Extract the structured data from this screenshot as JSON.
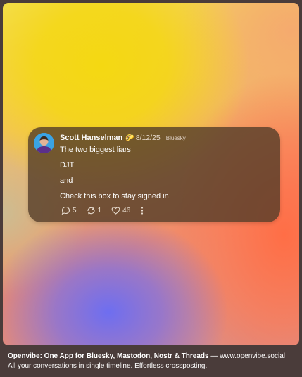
{
  "post": {
    "author": "Scott Hanselman",
    "badge": "🌮",
    "date": "8/12/25",
    "network": "Bluesky",
    "lines": [
      "The two biggest liars",
      "DJT",
      "and",
      "Check this box to stay signed in"
    ],
    "replies": "5",
    "reposts": "1",
    "likes": "46"
  },
  "footer": {
    "app_name": "Openvibe: One App for Bluesky, Mastodon, Nostr & Threads",
    "separator": " — ",
    "url": "www.openvibe.social",
    "tagline": "All your conversations in single timeline. Effortless crossposting."
  },
  "colors": {
    "card_bg": "#523c28",
    "yellow": "#f4d812",
    "orange": "#ff6e46",
    "blue": "#6e6ef0",
    "avatar_bg": "#3aa3e3"
  },
  "icons": [
    "reply-icon",
    "repost-icon",
    "heart-icon",
    "more-icon"
  ]
}
